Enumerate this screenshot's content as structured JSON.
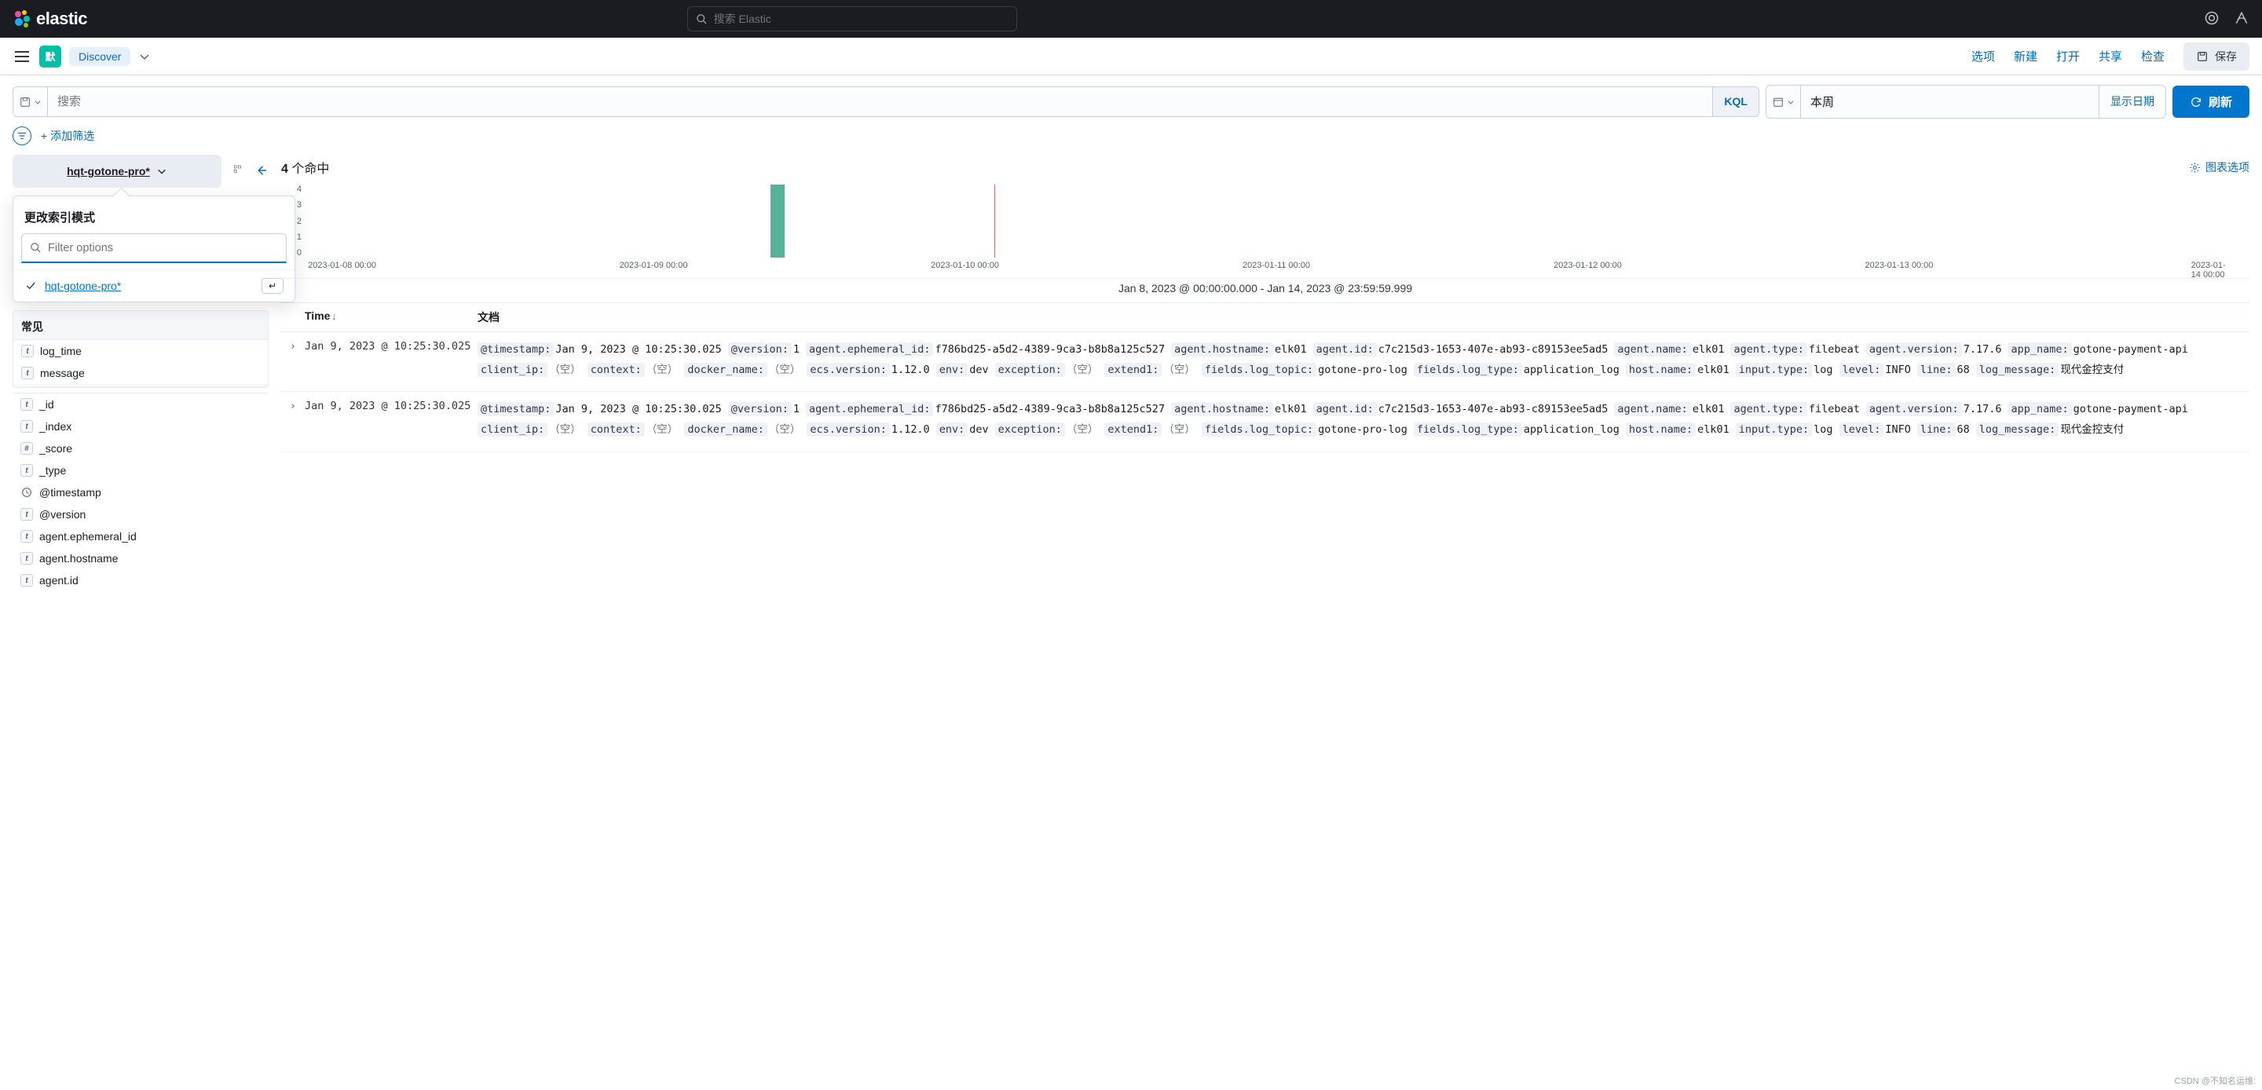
{
  "brand": "elastic",
  "global_search_placeholder": "搜索 Elastic",
  "space_badge": "默",
  "app_name": "Discover",
  "nav": {
    "options": "选项",
    "new": "新建",
    "open": "打开",
    "share": "共享",
    "inspect": "检查",
    "save": "保存"
  },
  "query": {
    "placeholder": "搜索",
    "lang": "KQL",
    "date_value": "本周",
    "show_dates": "显示日期",
    "refresh": "刷新",
    "add_filter": "+ 添加筛选"
  },
  "index_pattern_button": "hqt-gotone-pro*",
  "popover": {
    "title": "更改索引模式",
    "filter_placeholder": "Filter options",
    "option0": "hqt-gotone-pro*",
    "enter_glyph": "↵"
  },
  "sidebar": {
    "common_header": "常见",
    "common": [
      {
        "type": "t",
        "name": "log_time"
      },
      {
        "type": "t",
        "name": "message"
      }
    ],
    "available": [
      {
        "type": "t",
        "name": "_id"
      },
      {
        "type": "t",
        "name": "_index"
      },
      {
        "type": "#",
        "name": "_score"
      },
      {
        "type": "t",
        "name": "_type"
      },
      {
        "type": "clock",
        "name": "@timestamp"
      },
      {
        "type": "t",
        "name": "@version"
      },
      {
        "type": "t",
        "name": "agent.ephemeral_id"
      },
      {
        "type": "t",
        "name": "agent.hostname"
      },
      {
        "type": "t",
        "name": "agent.id"
      }
    ]
  },
  "hits": {
    "count": "4",
    "label": "个命中",
    "chart_options": "图表选项"
  },
  "chart_data": {
    "type": "bar",
    "categories": [
      "2023-01-08 00:00",
      "2023-01-09 00:00",
      "2023-01-10 00:00",
      "2023-01-11 00:00",
      "2023-01-12 00:00",
      "2023-01-13 00:00",
      "2023-01-14 00:00"
    ],
    "values": [
      0,
      0,
      4,
      0,
      0,
      0,
      0
    ],
    "marker_position_fraction": 0.355,
    "bar_position_fraction": 0.24,
    "ylim": [
      0,
      4
    ],
    "yticks": [
      0,
      1,
      2,
      3,
      4
    ],
    "time_range_text": "Jan 8, 2023 @ 00:00:00.000 - Jan 14, 2023 @ 23:59:59.999"
  },
  "table": {
    "col_time": "Time",
    "col_doc": "文档",
    "rows": [
      {
        "time": "Jan 9, 2023 @ 10:25:30.025",
        "doc": [
          {
            "k": "@timestamp:",
            "v": "Jan 9, 2023 @ 10:25:30.025"
          },
          {
            "k": "@version:",
            "v": "1"
          },
          {
            "k": "agent.ephemeral_id:",
            "v": "f786bd25-a5d2-4389-9ca3-b8b8a125c527"
          },
          {
            "k": "agent.hostname:",
            "v": "elk01"
          },
          {
            "k": "agent.id:",
            "v": "c7c215d3-1653-407e-ab93-c89153ee5ad5"
          },
          {
            "k": "agent.name:",
            "v": "elk01"
          },
          {
            "k": "agent.type:",
            "v": "filebeat"
          },
          {
            "k": "agent.version:",
            "v": "7.17.6"
          },
          {
            "k": "app_name:",
            "v": "gotone-payment-api"
          },
          {
            "k": "client_ip:",
            "v": "（空）",
            "empty": true
          },
          {
            "k": "context:",
            "v": "（空）",
            "empty": true
          },
          {
            "k": "docker_name:",
            "v": "（空）",
            "empty": true
          },
          {
            "k": "ecs.version:",
            "v": "1.12.0"
          },
          {
            "k": "env:",
            "v": "dev"
          },
          {
            "k": "exception:",
            "v": "（空）",
            "empty": true
          },
          {
            "k": "extend1:",
            "v": "（空）",
            "empty": true
          },
          {
            "k": "fields.log_topic:",
            "v": "gotone-pro-log"
          },
          {
            "k": "fields.log_type:",
            "v": "application_log"
          },
          {
            "k": "host.name:",
            "v": "elk01"
          },
          {
            "k": "input.type:",
            "v": "log"
          },
          {
            "k": "level:",
            "v": "INFO"
          },
          {
            "k": "line:",
            "v": "68"
          },
          {
            "k": "log_message:",
            "v": "现代金控支付"
          }
        ]
      },
      {
        "time": "Jan 9, 2023 @ 10:25:30.025",
        "doc": [
          {
            "k": "@timestamp:",
            "v": "Jan 9, 2023 @ 10:25:30.025"
          },
          {
            "k": "@version:",
            "v": "1"
          },
          {
            "k": "agent.ephemeral_id:",
            "v": "f786bd25-a5d2-4389-9ca3-b8b8a125c527"
          },
          {
            "k": "agent.hostname:",
            "v": "elk01"
          },
          {
            "k": "agent.id:",
            "v": "c7c215d3-1653-407e-ab93-c89153ee5ad5"
          },
          {
            "k": "agent.name:",
            "v": "elk01"
          },
          {
            "k": "agent.type:",
            "v": "filebeat"
          },
          {
            "k": "agent.version:",
            "v": "7.17.6"
          },
          {
            "k": "app_name:",
            "v": "gotone-payment-api"
          },
          {
            "k": "client_ip:",
            "v": "（空）",
            "empty": true
          },
          {
            "k": "context:",
            "v": "（空）",
            "empty": true
          },
          {
            "k": "docker_name:",
            "v": "（空）",
            "empty": true
          },
          {
            "k": "ecs.version:",
            "v": "1.12.0"
          },
          {
            "k": "env:",
            "v": "dev"
          },
          {
            "k": "exception:",
            "v": "（空）",
            "empty": true
          },
          {
            "k": "extend1:",
            "v": "（空）",
            "empty": true
          },
          {
            "k": "fields.log_topic:",
            "v": "gotone-pro-log"
          },
          {
            "k": "fields.log_type:",
            "v": "application_log"
          },
          {
            "k": "host.name:",
            "v": "elk01"
          },
          {
            "k": "input.type:",
            "v": "log"
          },
          {
            "k": "level:",
            "v": "INFO"
          },
          {
            "k": "line:",
            "v": "68"
          },
          {
            "k": "log_message:",
            "v": "现代金控支付"
          }
        ]
      }
    ]
  },
  "watermark": "CSDN @不知名运维:"
}
